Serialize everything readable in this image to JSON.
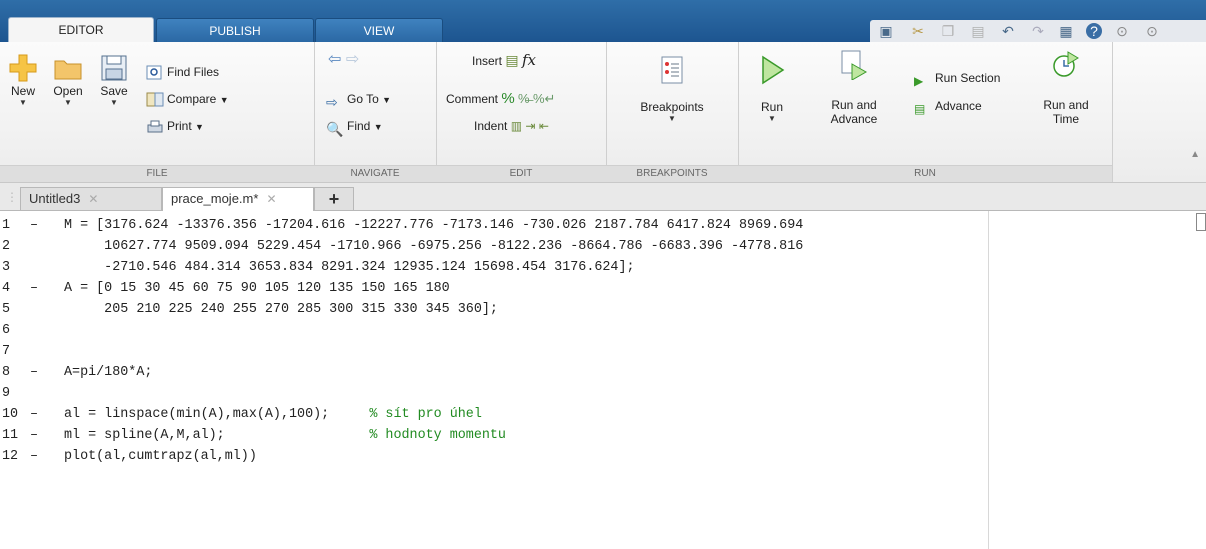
{
  "tabs": [
    {
      "label": "EDITOR"
    },
    {
      "label": "PUBLISH"
    },
    {
      "label": "VIEW"
    }
  ],
  "ribbon": {
    "file": {
      "label": "FILE",
      "new": "New",
      "open": "Open",
      "save": "Save",
      "find_files": "Find Files",
      "compare": "Compare",
      "print": "Print"
    },
    "navigate": {
      "label": "NAVIGATE",
      "goto": "Go To",
      "find": "Find"
    },
    "edit": {
      "label": "EDIT",
      "insert": "Insert",
      "comment": "Comment",
      "indent": "Indent",
      "fx": "fx"
    },
    "breakpoints": {
      "label": "BREAKPOINTS",
      "button": "Breakpoints"
    },
    "run": {
      "label": "RUN",
      "run": "Run",
      "run_and_advance_1": "Run and",
      "run_and_advance_2": "Advance",
      "run_section": "Run Section",
      "advance": "Advance",
      "run_and_time_1": "Run and",
      "run_and_time_2": "Time"
    }
  },
  "documents": [
    {
      "name": "Untitled3"
    },
    {
      "name": "prace_moje.m*"
    }
  ],
  "add_tab": "+",
  "code": [
    {
      "num": "1",
      "mark": "–",
      "text": "M = [3176.624 -13376.356 -17204.616 -12227.776 -7173.146 -730.026 2187.784 6417.824 8969.694",
      "comment": ""
    },
    {
      "num": "2",
      "mark": "",
      "text": "     10627.774 9509.094 5229.454 -1710.966 -6975.256 -8122.236 -8664.786 -6683.396 -4778.816",
      "comment": ""
    },
    {
      "num": "3",
      "mark": "",
      "text": "     -2710.546 484.314 3653.834 8291.324 12935.124 15698.454 3176.624];",
      "comment": ""
    },
    {
      "num": "4",
      "mark": "–",
      "text": "A = [0 15 30 45 60 75 90 105 120 135 150 165 180",
      "comment": ""
    },
    {
      "num": "5",
      "mark": "",
      "text": "     205 210 225 240 255 270 285 300 315 330 345 360];",
      "comment": ""
    },
    {
      "num": "6",
      "mark": "",
      "text": "",
      "comment": ""
    },
    {
      "num": "7",
      "mark": "",
      "text": "",
      "comment": ""
    },
    {
      "num": "8",
      "mark": "–",
      "text": "A=pi/180*A;",
      "comment": ""
    },
    {
      "num": "9",
      "mark": "",
      "text": "",
      "comment": ""
    },
    {
      "num": "10",
      "mark": "–",
      "text": "al = linspace(min(A),max(A),100);     ",
      "comment": "% sít pro úhel"
    },
    {
      "num": "11",
      "mark": "–",
      "text": "ml = spline(A,M,al);                  ",
      "comment": "% hodnoty momentu"
    },
    {
      "num": "12",
      "mark": "–",
      "text": "plot(al,cumtrapz(al,ml))",
      "comment": ""
    }
  ]
}
